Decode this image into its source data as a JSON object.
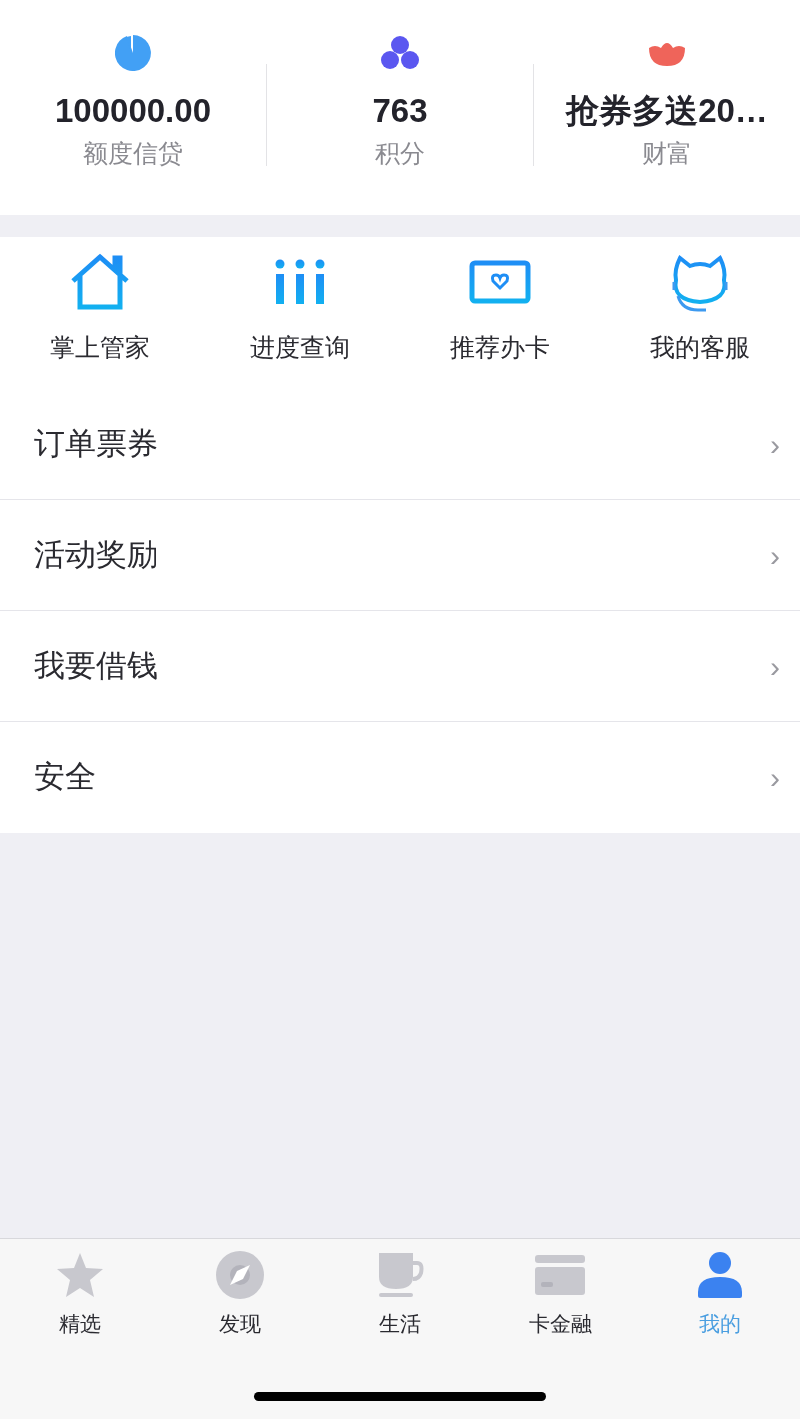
{
  "stats": [
    {
      "kind": "pie",
      "value": "100000.00",
      "label": "额度信贷"
    },
    {
      "kind": "dots",
      "value": "763",
      "label": "积分"
    },
    {
      "kind": "flower",
      "value": "抢券多送20…",
      "label": "财富"
    }
  ],
  "shortcuts": [
    {
      "kind": "house",
      "label": "掌上管家"
    },
    {
      "kind": "bars",
      "label": "进度查询"
    },
    {
      "kind": "card",
      "label": "推荐办卡"
    },
    {
      "kind": "service",
      "label": "我的客服"
    }
  ],
  "menu": [
    {
      "label": "订单票券",
      "chevron": "›"
    },
    {
      "label": "活动奖励",
      "chevron": "›"
    },
    {
      "label": "我要借钱",
      "chevron": "›"
    },
    {
      "label": "安全",
      "chevron": "›"
    }
  ],
  "tab_bar": [
    {
      "kind": "star",
      "label": "精选",
      "selected": false
    },
    {
      "kind": "compass",
      "label": "发现",
      "selected": false
    },
    {
      "kind": "cup",
      "label": "生活",
      "selected": false
    },
    {
      "kind": "card",
      "label": "卡金融",
      "selected": false
    },
    {
      "kind": "person",
      "label": "我的",
      "selected": true
    }
  ]
}
